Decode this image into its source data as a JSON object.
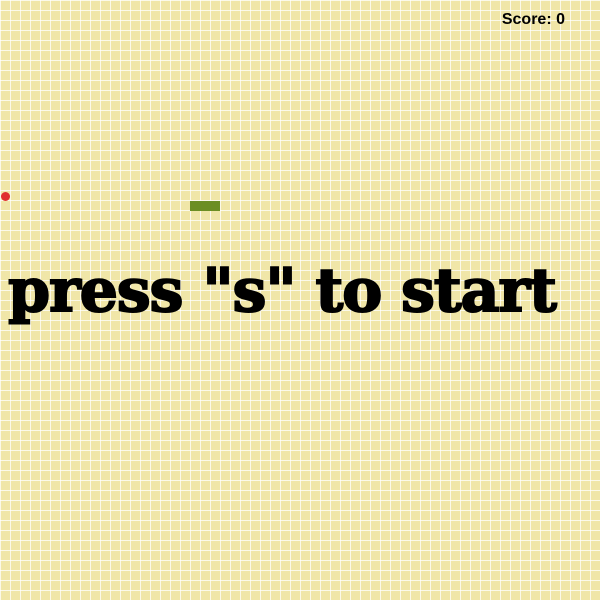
{
  "game": {
    "score_label": "Score: 0",
    "start_message": "press \"s\" to start",
    "snake_length": 3
  },
  "colors": {
    "board": "#f0e6a8",
    "grid_lines": "#ffffff",
    "snake": "#6b8e23",
    "food": "#e03030",
    "text": "#000000"
  },
  "icons": {
    "food": "apple-dot-icon"
  }
}
